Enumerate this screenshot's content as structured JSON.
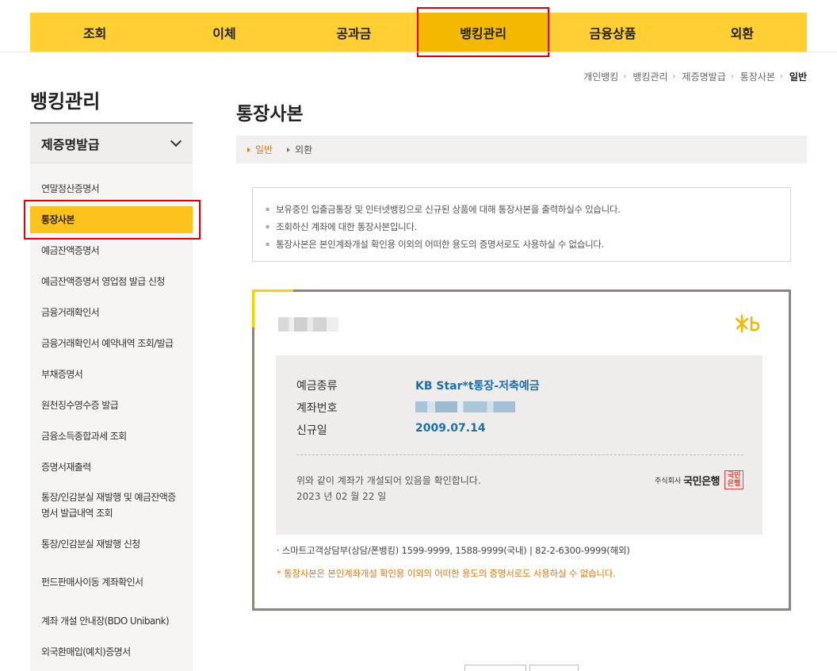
{
  "gnb": {
    "items": [
      "조회",
      "이체",
      "공과금",
      "뱅킹관리",
      "금융상품",
      "외환"
    ],
    "active_index": 3
  },
  "breadcrumb": [
    "개인뱅킹",
    "뱅킹관리",
    "제증명발급",
    "통장사본",
    "일반"
  ],
  "sidebar": {
    "title": "뱅킹관리",
    "section": "제증명발급",
    "items": [
      "연말정산증명서",
      "통장사본",
      "예금잔액증명서",
      "예금잔액증명서 영업점 발급 신청",
      "금융거래확인서",
      "금융거래확인서 예약내역 조회/발급",
      "부채증명서",
      "원천징수영수증 발급",
      "금융소득종합과세 조회",
      "증명서재출력",
      "통장/인감분실 재발행 및 예금잔액증명서 발급내역 조회",
      "통장/인감분실 재발행 신청",
      "펀드판매사이동 계좌확인서",
      "계좌 개설 안내장(BDO Unibank)",
      "외국환매입(예치)증명서"
    ],
    "active_index": 1
  },
  "main": {
    "title": "통장사본",
    "tabs": [
      "일반",
      "외환"
    ],
    "active_tab": 0,
    "notices": [
      "보유중인 입출금통장 및 인터넷뱅킹으로 신규된 상품에 대해 통장사본을 출력하실수 있습니다.",
      "조회하신 계좌에 대한 통장사본입니다.",
      "통장사본은 본인계좌개설 확인용 이외의 어떠한 용도의 증명서로도 사용하실 수 없습니다."
    ]
  },
  "passbook": {
    "logo": "KB",
    "rows": {
      "type_label": "예금종류",
      "type_value": "KB Star*t통장-저축예금",
      "account_label": "계좌번호",
      "open_label": "신규일",
      "open_value": "2009.07.14"
    },
    "confirm_text": "위와 같이 계좌가 개설되어 있음을 확인합니다.",
    "confirm_date": "2023 년 02 월 22 일",
    "bank_prefix": "주식회사",
    "bank_name": "국민은행",
    "seal_text": "국민은행",
    "contact": "· 스마트고객상담부(상담/폰뱅킹) 1599-9999, 1588-9999(국내) | 82-2-6300-9999(해외)",
    "warning": "* 통장사본은 본인계좌개설 확인용 이외의 어떠한 용도의 증명서로도 사용하실 수 없습니다."
  },
  "colors": {
    "gnb_bg": "#ffcf33",
    "gnb_active": "#f5b800",
    "accent_orange": "#e07a10",
    "value_blue": "#1e6fa8",
    "highlight_red": "#e60000"
  }
}
